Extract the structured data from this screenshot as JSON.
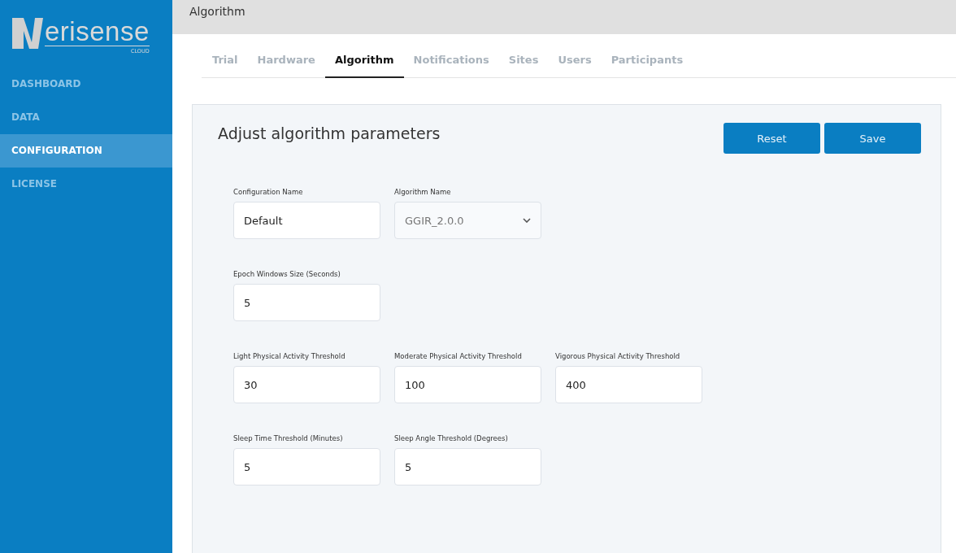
{
  "logo": {
    "wordmark": "erisense",
    "subtitle": "CLOUD"
  },
  "sidebar": {
    "items": [
      {
        "label": "DASHBOARD",
        "selected": false
      },
      {
        "label": "DATA",
        "selected": false
      },
      {
        "label": "CONFIGURATION",
        "selected": true
      },
      {
        "label": "LICENSE",
        "selected": false
      }
    ]
  },
  "header": {
    "title": "Algorithm"
  },
  "tabs": [
    {
      "label": "Trial",
      "selected": false
    },
    {
      "label": "Hardware",
      "selected": false
    },
    {
      "label": "Algorithm",
      "selected": true
    },
    {
      "label": "Notifications",
      "selected": false
    },
    {
      "label": "Sites",
      "selected": false
    },
    {
      "label": "Users",
      "selected": false
    },
    {
      "label": "Participants",
      "selected": false
    }
  ],
  "card": {
    "title": "Adjust algorithm parameters",
    "buttons": [
      "Reset",
      "Save"
    ],
    "rows": [
      {
        "fields": [
          {
            "label": "Configuration Name",
            "value": "Default",
            "kind": "text"
          },
          {
            "label": "Algorithm Name",
            "value": "GGIR_2.0.0",
            "kind": "select"
          }
        ]
      },
      {
        "fields": [
          {
            "label": "Epoch Windows Size (Seconds)",
            "value": "5",
            "kind": "text"
          }
        ]
      },
      {
        "fields": [
          {
            "label": "Light Physical Activity Threshold",
            "value": "30",
            "kind": "text"
          },
          {
            "label": "Moderate Physical Activity Threshold",
            "value": "100",
            "kind": "text"
          },
          {
            "label": "Vigorous Physical Activity Threshold",
            "value": "400",
            "kind": "text"
          }
        ]
      },
      {
        "fields": [
          {
            "label": "Sleep Time Threshold (Minutes)",
            "value": "5",
            "kind": "text"
          },
          {
            "label": "Sleep Angle Threshold (Degrees)",
            "value": "5",
            "kind": "text"
          }
        ]
      }
    ]
  }
}
